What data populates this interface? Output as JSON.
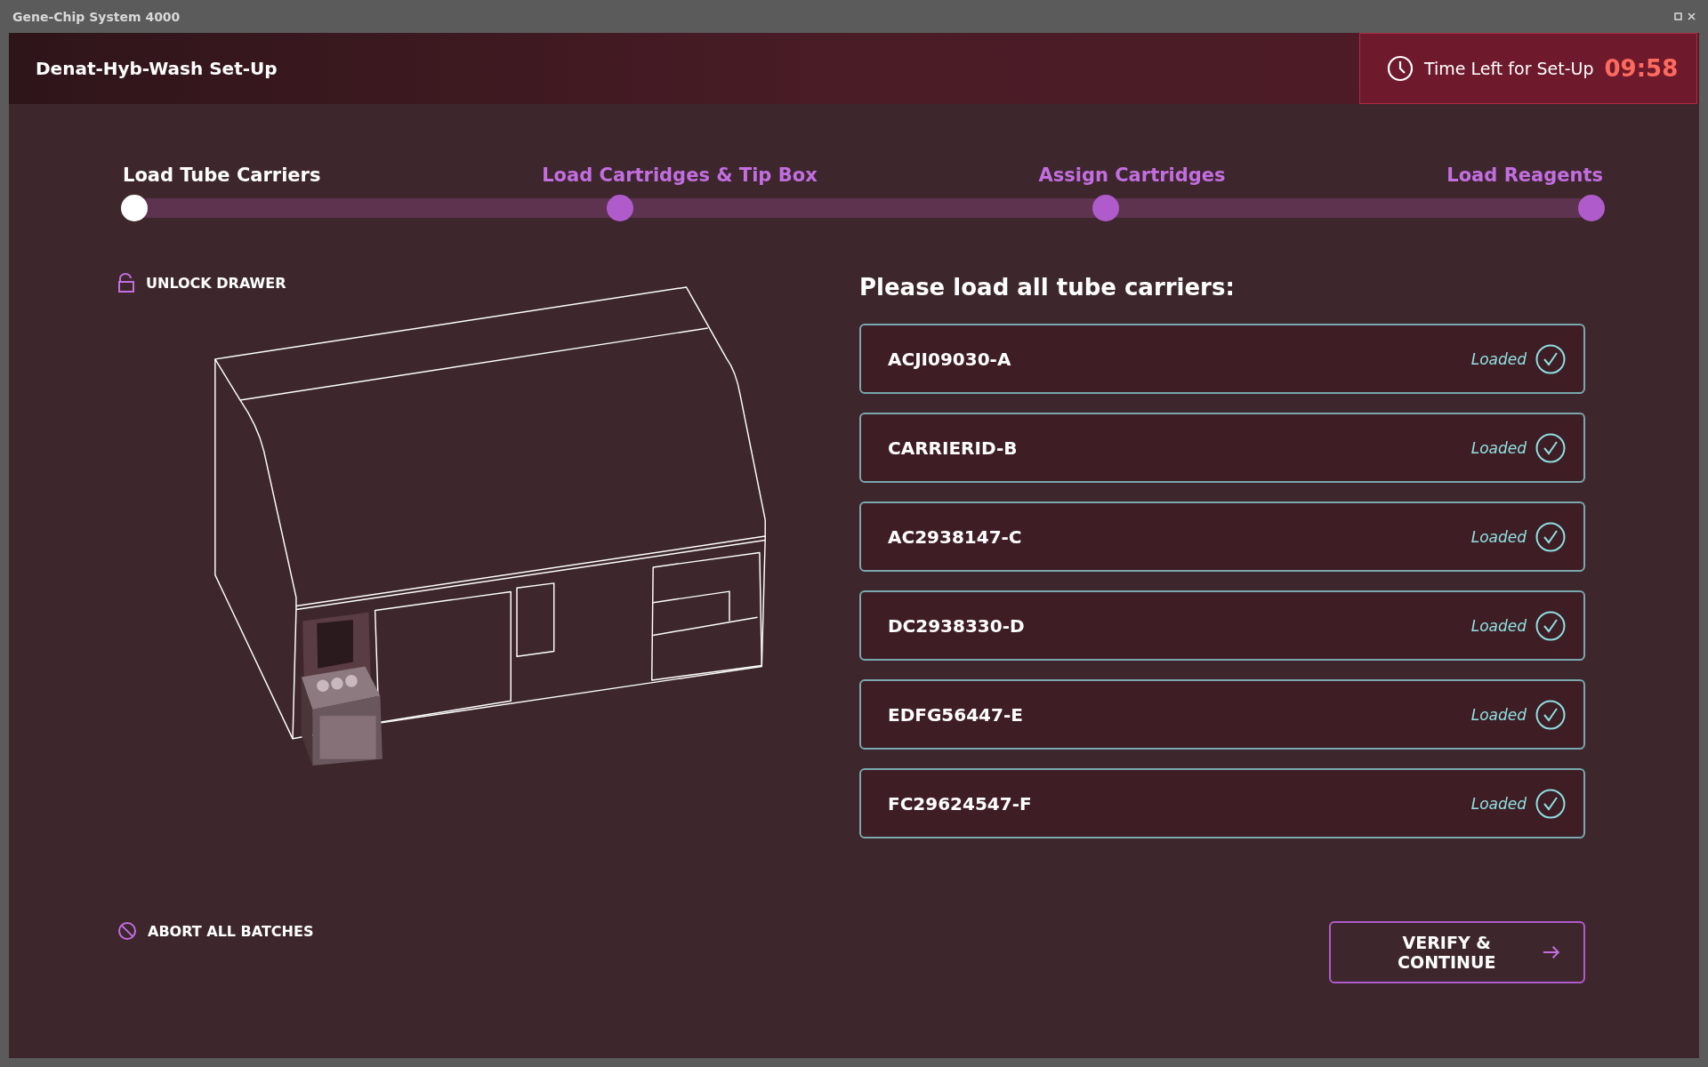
{
  "window": {
    "title": "Gene-Chip System 4000"
  },
  "header": {
    "title": "Denat-Hyb-Wash Set-Up",
    "timer_label": "Time Left for Set-Up",
    "timer_value": "09:58"
  },
  "steps": [
    {
      "label": "Load Tube Carriers",
      "selected": true
    },
    {
      "label": "Load Cartridges & Tip Box",
      "selected": false
    },
    {
      "label": "Assign Cartridges",
      "selected": false
    },
    {
      "label": "Load Reagents",
      "selected": false
    }
  ],
  "unlock_label": "UNLOCK DRAWER",
  "prompt": "Please load all tube carriers:",
  "carriers": [
    {
      "id": "ACJI09030-A",
      "status": "Loaded",
      "loaded": true
    },
    {
      "id": "CARRIERID-B",
      "status": "Loaded",
      "loaded": true
    },
    {
      "id": "AC2938147-C",
      "status": "Loaded",
      "loaded": true
    },
    {
      "id": "DC2938330-D",
      "status": "Loaded",
      "loaded": true
    },
    {
      "id": "EDFG56447-E",
      "status": "Loaded",
      "loaded": true
    },
    {
      "id": "FC29624547-F",
      "status": "Loaded",
      "loaded": true
    }
  ],
  "abort_label": "ABORT ALL BATCHES",
  "continue_label": "VERIFY & CONTINUE"
}
